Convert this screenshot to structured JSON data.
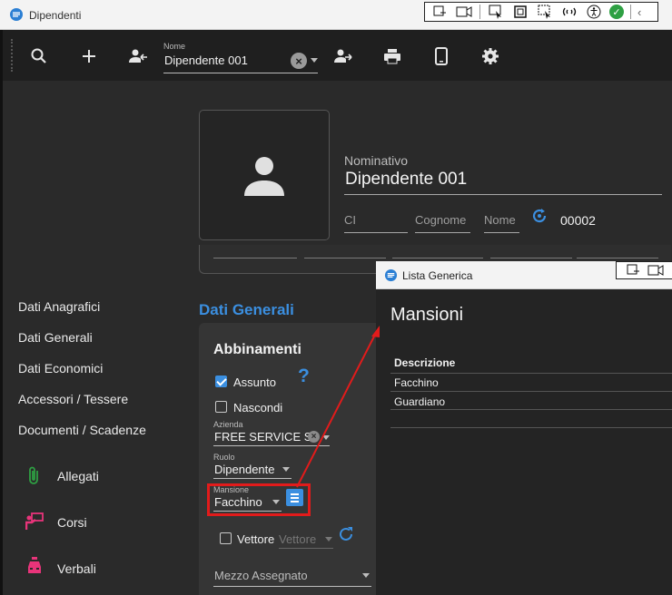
{
  "window": {
    "title": "Dipendenti"
  },
  "toolbar": {
    "name_field_label": "Nome",
    "name_field_value": "Dipendente 001"
  },
  "employee": {
    "nominativo_label": "Nominativo",
    "nominativo_value": "Dipendente 001",
    "ci_label": "CI",
    "cognome_label": "Cognome",
    "nome_label": "Nome",
    "code": "00002"
  },
  "sidebar": {
    "items": [
      {
        "label": "Dati Anagrafici"
      },
      {
        "label": "Dati Generali"
      },
      {
        "label": "Dati Economici"
      },
      {
        "label": "Accessori / Tessere"
      },
      {
        "label": "Documenti / Scadenze"
      }
    ],
    "icon_items": [
      {
        "label": "Allegati",
        "icon": "paperclip-icon",
        "color": "#2ea043"
      },
      {
        "label": "Corsi",
        "icon": "teacher-icon",
        "color": "#e8347a"
      },
      {
        "label": "Verbali",
        "icon": "police-car-icon",
        "color": "#e8347a"
      }
    ]
  },
  "section": {
    "title": "Dati Generali",
    "card_title": "Abbinamenti",
    "assunto_label": "Assunto",
    "assunto_checked": true,
    "nascondi_label": "Nascondi",
    "nascondi_checked": false,
    "azienda_label": "Azienda",
    "azienda_value": "FREE SERVICE SRL",
    "ruolo_label": "Ruolo",
    "ruolo_value": "Dipendente",
    "mansione_label": "Mansione",
    "mansione_value": "Facchino",
    "vettore_label": "Vettore",
    "vettore_placeholder": "Vettore",
    "mezzo_label": "Mezzo Assegnato"
  },
  "popup": {
    "title": "Lista Generica",
    "heading": "Mansioni",
    "column_header": "Descrizione",
    "rows": [
      "Facchino",
      "Guardiano"
    ]
  },
  "colors": {
    "accent": "#3b8fe0",
    "highlight": "#e21b1b"
  }
}
